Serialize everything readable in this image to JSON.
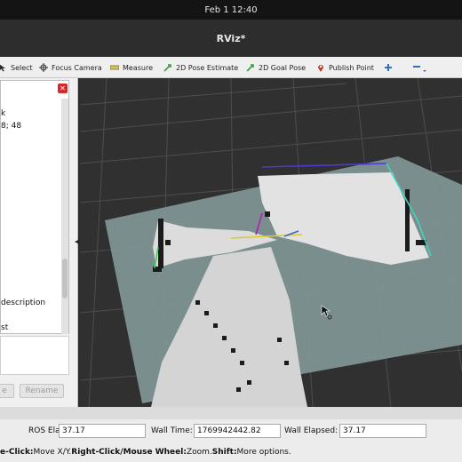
{
  "system": {
    "clock": "Feb 1  12:40"
  },
  "window": {
    "title": "RViz*"
  },
  "toolbar": {
    "select": "Select",
    "focus_camera": "Focus Camera",
    "measure": "Measure",
    "pose_estimate": "2D Pose Estimate",
    "goal_pose": "2D Goal Pose",
    "publish_point": "Publish Point"
  },
  "left_panel": {
    "line1": "k",
    "line2": "8; 48",
    "desc_heading": "description",
    "desc_tail": "st",
    "btn_left": "e",
    "btn_rename": "Rename"
  },
  "status": {
    "ros_elapsed_label": "ROS Elapsed:",
    "ros_elapsed_value": "37.17",
    "wall_time_label": "Wall Time:",
    "wall_time_value": "1769942442.82",
    "wall_elapsed_label": "Wall Elapsed:",
    "wall_elapsed_value": "37.17"
  },
  "hint": {
    "part1_bold": "e-Click:",
    "part1": " Move X/Y. ",
    "part2_bold": "Right-Click/Mouse Wheel:",
    "part2": " Zoom. ",
    "part3_bold": "Shift:",
    "part3": " More options."
  },
  "colors": {
    "viewport_bg": "#303030",
    "grid_line": "#4a4a4a",
    "map_floor": "#7f9493",
    "free_space": "#e0e0e0",
    "accent": "#1565c0"
  }
}
